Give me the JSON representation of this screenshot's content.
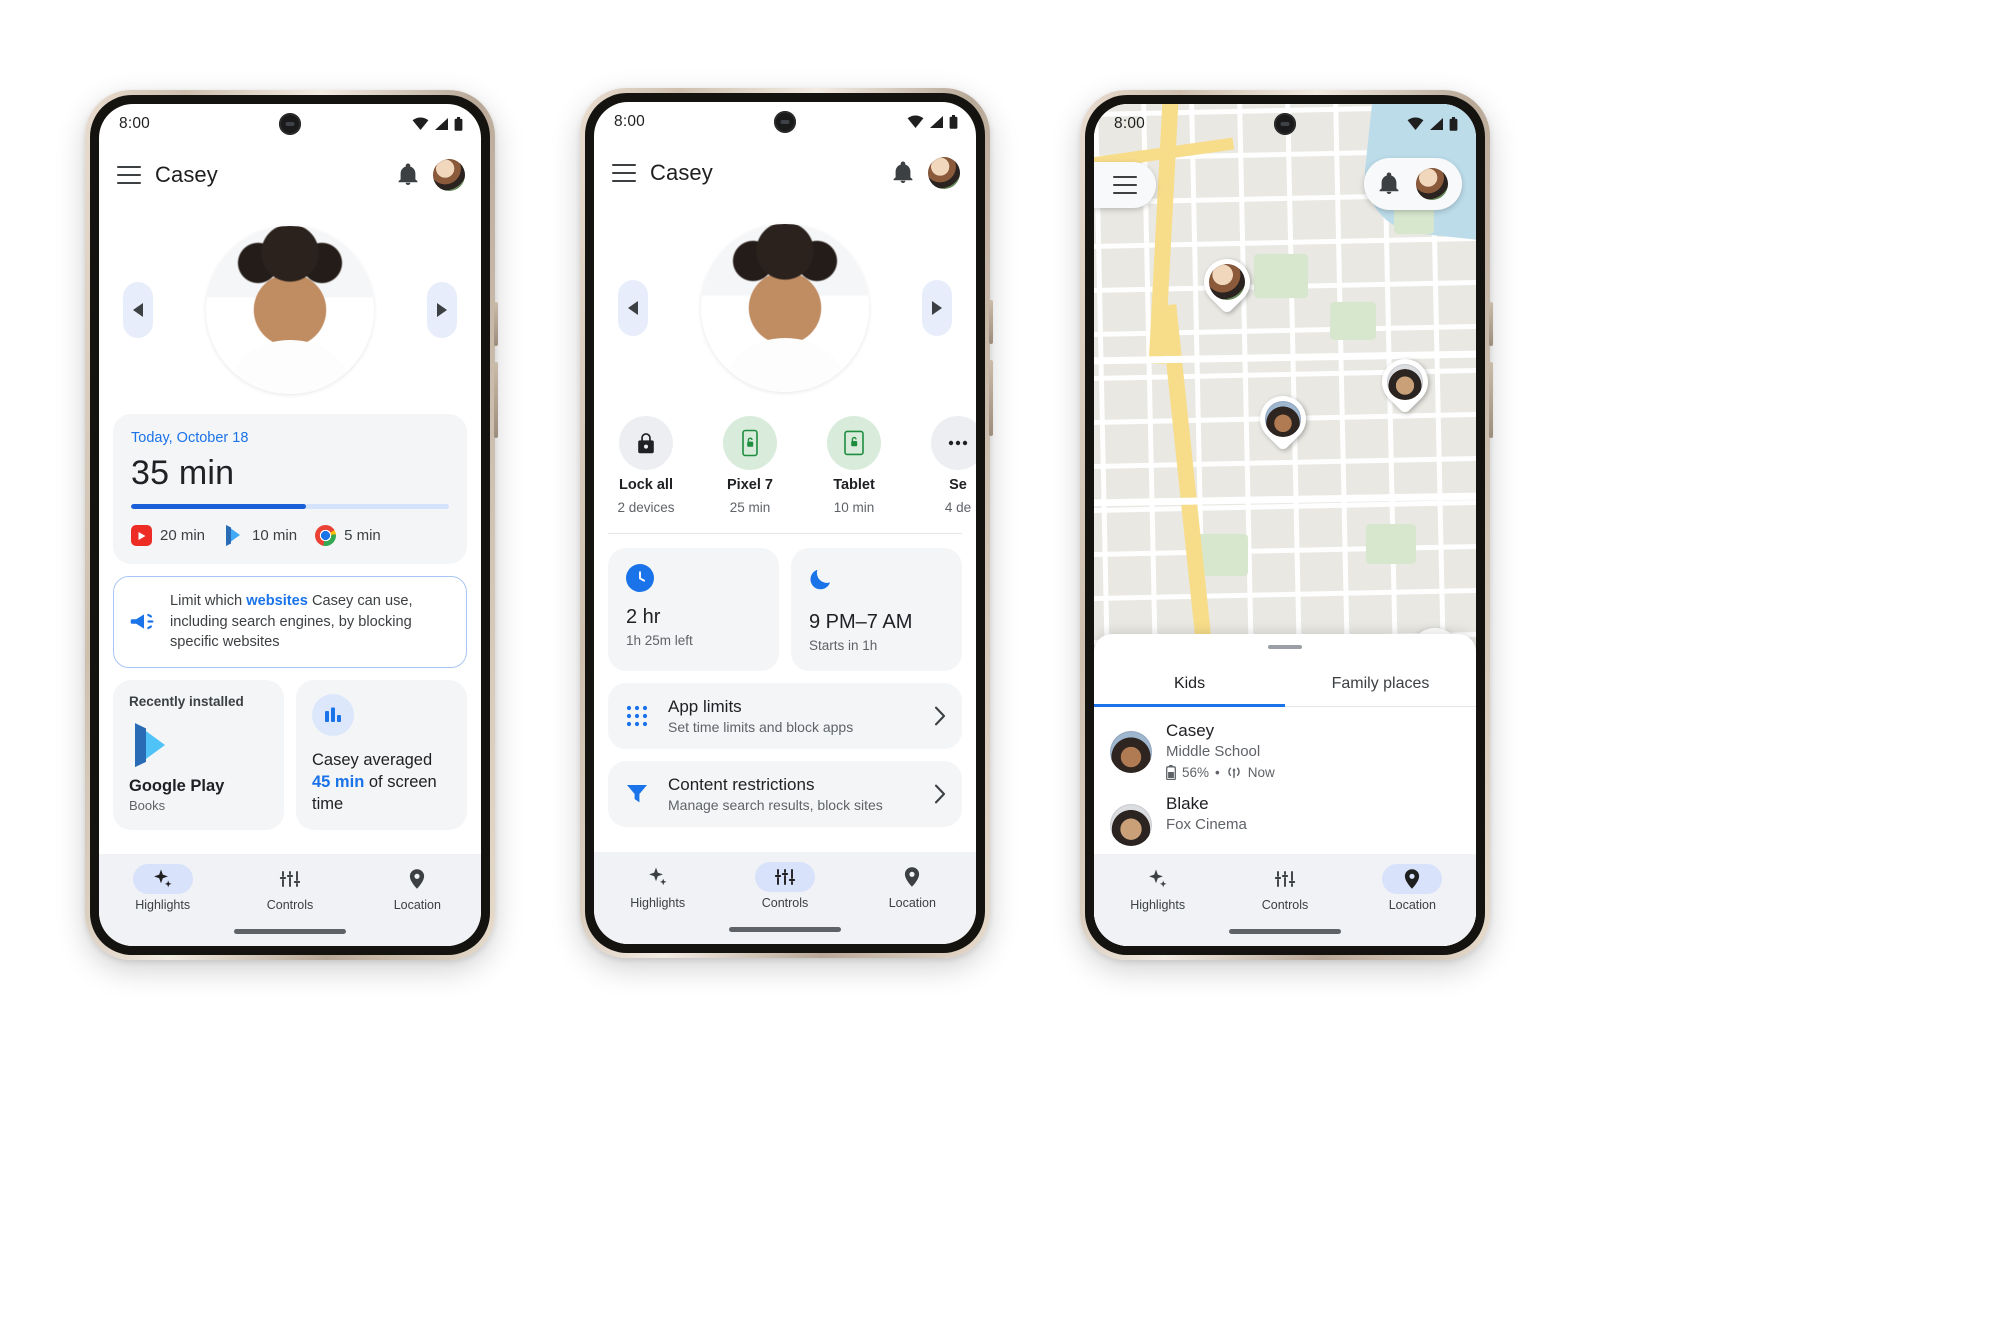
{
  "statusbar": {
    "time": "8:00",
    "icons": [
      "wifi-icon",
      "signal-icon",
      "battery-icon"
    ]
  },
  "phone1": {
    "appbar": {
      "menu_icon": "hamburger-menu-icon",
      "title": "Casey",
      "bell_icon": "notifications-bell-icon",
      "avatar": "parent-avatar"
    },
    "carousel": {
      "prev": "chevron-left-icon",
      "next": "chevron-right-icon",
      "photo": "child-photo-casey"
    },
    "screentime": {
      "date": "Today, October 18",
      "total": "35 min",
      "progress_percent": 55,
      "apps": [
        {
          "icon": "youtube-icon",
          "time": "20 min"
        },
        {
          "icon": "google-play-icon",
          "time": "10 min"
        },
        {
          "icon": "chrome-icon",
          "time": "5 min"
        }
      ]
    },
    "notice": {
      "icon": "megaphone-icon",
      "text_before": "Limit which ",
      "highlight": "websites",
      "text_after": " Casey can use, including search engines, by blocking specific websites"
    },
    "cards": {
      "recent": {
        "label": "Recently installed",
        "icon": "google-play-icon",
        "name": "Google Play",
        "sub": "Books"
      },
      "average": {
        "icon": "bar-chart-icon",
        "text_before": "Casey averaged ",
        "highlight": "45 min",
        "text_after": " of screen time"
      }
    },
    "nav": [
      {
        "icon": "sparkle-icon",
        "label": "Highlights",
        "active": true
      },
      {
        "icon": "sliders-icon",
        "label": "Controls",
        "active": false
      },
      {
        "icon": "location-pin-icon",
        "label": "Location",
        "active": false
      }
    ]
  },
  "phone2": {
    "appbar": {
      "menu_icon": "hamburger-menu-icon",
      "title": "Casey",
      "bell_icon": "notifications-bell-icon",
      "avatar": "parent-avatar"
    },
    "carousel": {
      "prev": "chevron-left-icon",
      "next": "chevron-right-icon",
      "photo": "child-photo-casey"
    },
    "devices": [
      {
        "icon": "lock-icon",
        "tone": "grey",
        "name": "Lock all",
        "sub": "2 devices"
      },
      {
        "icon": "phone-unlock-icon",
        "tone": "green",
        "name": "Pixel 7",
        "sub": "25 min"
      },
      {
        "icon": "tablet-unlock-icon",
        "tone": "green",
        "name": "Tablet",
        "sub": "10 min"
      },
      {
        "icon": "more-icon",
        "tone": "grey",
        "name": "Se",
        "sub": "4 de"
      }
    ],
    "tiles": [
      {
        "icon": "clock-icon",
        "value": "2 hr",
        "sub": "1h 25m left"
      },
      {
        "icon": "moon-icon",
        "value": "9 PM–7 AM",
        "sub": "Starts in 1h"
      }
    ],
    "rows": [
      {
        "icon": "grid-dots-icon",
        "title": "App limits",
        "desc": "Set time limits and block apps",
        "chevron": "chevron-right-icon"
      },
      {
        "icon": "filter-funnel-icon",
        "title": "Content restrictions",
        "desc": "Manage search results, block sites",
        "chevron": "chevron-right-icon"
      }
    ],
    "nav": [
      {
        "icon": "sparkle-icon",
        "label": "Highlights",
        "active": false
      },
      {
        "icon": "sliders-icon",
        "label": "Controls",
        "active": true
      },
      {
        "icon": "location-pin-icon",
        "label": "Location",
        "active": false
      }
    ]
  },
  "phone3": {
    "map": {
      "menu_icon": "hamburger-menu-icon",
      "bell_icon": "notifications-bell-icon",
      "avatar": "parent-avatar",
      "locate_icon": "my-location-icon",
      "markers": [
        "map-marker-parent",
        "map-marker-blake",
        "map-marker-casey"
      ]
    },
    "sheet": {
      "tabs": [
        {
          "label": "Kids",
          "active": true
        },
        {
          "label": "Family places",
          "active": false
        }
      ],
      "kids": [
        {
          "avatar": "child-photo-casey",
          "name": "Casey",
          "place": "Middle School",
          "battery_icon": "battery-icon",
          "battery": "56%",
          "dot": "•",
          "signal_icon": "signal-waves-icon",
          "updated": "Now"
        },
        {
          "avatar": "child-photo-blake",
          "name": "Blake",
          "place": "Fox Cinema",
          "battery_icon": "",
          "battery": "",
          "dot": "",
          "signal_icon": "",
          "updated": ""
        }
      ]
    },
    "nav": [
      {
        "icon": "sparkle-icon",
        "label": "Highlights",
        "active": false
      },
      {
        "icon": "sliders-icon",
        "label": "Controls",
        "active": false
      },
      {
        "icon": "location-pin-icon",
        "label": "Location",
        "active": true
      }
    ]
  },
  "colors": {
    "accent": "#1a73e8",
    "progress_fill": "#1a5fd8",
    "green_tone": "#d9ecdc",
    "nav_pill": "#d8e2fb"
  }
}
